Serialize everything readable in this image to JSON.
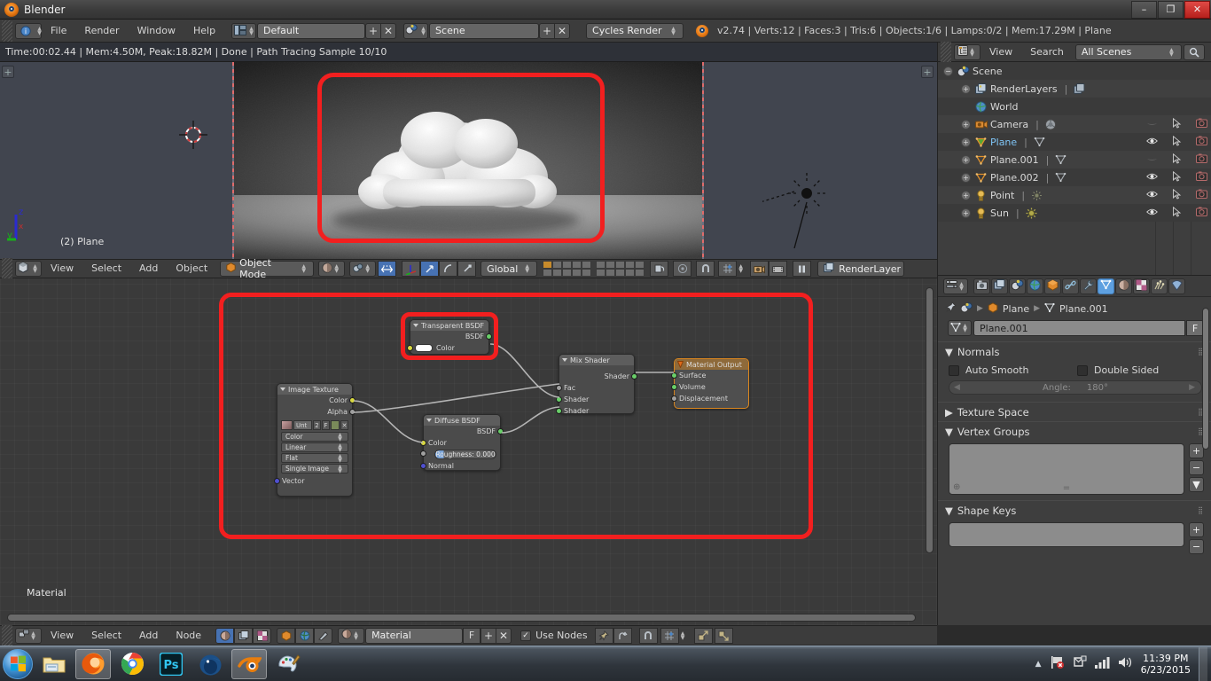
{
  "window": {
    "title": "Blender",
    "icon": "blender-logo-icon",
    "buttons": {
      "minimize": "–",
      "maximize": "❐",
      "close": "✕"
    }
  },
  "topbar": {
    "info_icon": "info-editor-icon",
    "menus": [
      "File",
      "Render",
      "Window",
      "Help"
    ],
    "screen_layout": {
      "icon": "screen-layout-icon",
      "value": "Default",
      "add": "+",
      "remove": "✕"
    },
    "scene": {
      "icon": "scene-icon",
      "value": "Scene",
      "add": "+",
      "remove": "✕"
    },
    "render_engine": {
      "value": "Cycles Render"
    },
    "version_stats": "v2.74 | Verts:12 | Faces:3 | Tris:6 | Objects:1/6 | Lamps:0/2 | Mem:17.29M | Plane"
  },
  "render_info": {
    "text": "Time:00:02.44 | Mem:4.50M, Peak:18.82M | Done | Path Tracing Sample 10/10"
  },
  "viewport": {
    "object_label": "(2) Plane",
    "axis": {
      "x": "x",
      "y": "y",
      "z": "z"
    },
    "cursor": "3d-cursor-icon",
    "lamp": "sun-lamp-icon",
    "render_subject": "cloud render preview"
  },
  "viewport_header": {
    "editor_icon": "3d-view-editor-icon",
    "menus": [
      "View",
      "Select",
      "Add",
      "Object"
    ],
    "mode": "Object Mode",
    "shading": "rendered-shading-icon",
    "pivot": "pivot-icon",
    "manipulator_icons": [
      "translate-manipulator-icon",
      "rotate-manipulator-icon",
      "scale-manipulator-icon"
    ],
    "orientation": "Global",
    "layers_label": "scene-layers",
    "extra_icons": [
      "proportional-edit-icon",
      "snap-magnet-icon",
      "snap-target-icon",
      "render-camera-icon",
      "render-animation-icon",
      "pause-icon"
    ],
    "render_layer": "RenderLayer"
  },
  "node_editor": {
    "area_label": "Material",
    "nodes": [
      {
        "id": "image-texture",
        "title": "Image Texture",
        "outputs": [
          "Color",
          "Alpha"
        ],
        "datablock": {
          "name": "Unt",
          "users": "2",
          "fake_user": "F",
          "new": "new-image-icon",
          "unlink": "✕"
        },
        "dropdowns": [
          "Color",
          "Linear",
          "Flat",
          "Single Image"
        ],
        "inputs": [
          "Vector"
        ]
      },
      {
        "id": "transparent-bsdf",
        "title": "Transparent BSDF",
        "outputs": [
          "BSDF"
        ],
        "inputs": [
          "Color"
        ],
        "color_swatch": "#ffffff"
      },
      {
        "id": "diffuse-bsdf",
        "title": "Diffuse BSDF",
        "outputs": [
          "BSDF"
        ],
        "inputs": [
          "Color",
          "Normal"
        ],
        "roughness_label": "Roughness:",
        "roughness_value": "0.000"
      },
      {
        "id": "mix-shader",
        "title": "Mix Shader",
        "outputs": [
          "Shader"
        ],
        "inputs": [
          "Fac",
          "Shader",
          "Shader"
        ]
      },
      {
        "id": "material-output",
        "title": "Material Output",
        "inputs": [
          "Surface",
          "Volume",
          "Displacement"
        ]
      }
    ],
    "highlight_color": "#f21f1f"
  },
  "node_header": {
    "editor_icon": "node-editor-icon",
    "menus": [
      "View",
      "Select",
      "Add",
      "Node"
    ],
    "tree_type_icons": [
      "shader-nodes-icon",
      "compositing-nodes-icon",
      "texture-nodes-icon"
    ],
    "shader_type_icons": [
      "object-icon",
      "world-icon",
      "linestyle-icon"
    ],
    "datablock": {
      "icon": "material-icon",
      "value": "Material",
      "fake_user": "F",
      "add": "+",
      "remove": "✕"
    },
    "use_nodes": {
      "label": "Use Nodes",
      "checked": true
    },
    "pin_icon": "pin-icon",
    "go_parent_icon": "go-to-parent-icon",
    "snap_icons": [
      "snap-magnet-icon",
      "snap-node-icon"
    ],
    "group_icons": [
      "group-insert-icon",
      "group-exit-icon"
    ]
  },
  "outliner": {
    "editor_icon": "outliner-editor-icon",
    "menus": [
      "View",
      "Search"
    ],
    "display_mode": "All Scenes",
    "search_icon": "magnifier-icon",
    "rows": [
      {
        "name": "Scene",
        "icon": "scene-icon",
        "indent": 0,
        "expander": "−",
        "selected": false,
        "show_toggles": false,
        "datatype": ""
      },
      {
        "name": "RenderLayers",
        "icon": "renderlayers-icon",
        "indent": 1,
        "expander": "+",
        "selected": false,
        "show_toggles": false,
        "datatype": "renderlayer-icon"
      },
      {
        "name": "World",
        "icon": "world-icon",
        "indent": 1,
        "expander": "",
        "selected": false,
        "show_toggles": false,
        "datatype": ""
      },
      {
        "name": "Camera",
        "icon": "camera-icon",
        "indent": 1,
        "expander": "+",
        "selected": false,
        "show_toggles": true,
        "datatype": "camera-data-icon",
        "visible": false
      },
      {
        "name": "Plane",
        "icon": "mesh-icon",
        "indent": 1,
        "expander": "+",
        "selected": true,
        "show_toggles": true,
        "datatype": "mesh-data-icon",
        "visible": true
      },
      {
        "name": "Plane.001",
        "icon": "mesh-icon",
        "indent": 1,
        "expander": "+",
        "selected": false,
        "show_toggles": true,
        "datatype": "mesh-data-icon",
        "visible": false
      },
      {
        "name": "Plane.002",
        "icon": "mesh-icon",
        "indent": 1,
        "expander": "+",
        "selected": false,
        "show_toggles": true,
        "datatype": "mesh-data-icon",
        "visible": true
      },
      {
        "name": "Point",
        "icon": "lamp-icon",
        "indent": 1,
        "expander": "+",
        "selected": false,
        "show_toggles": true,
        "datatype": "point-lamp-icon",
        "visible": true
      },
      {
        "name": "Sun",
        "icon": "lamp-icon",
        "indent": 1,
        "expander": "+",
        "selected": false,
        "show_toggles": true,
        "datatype": "sun-lamp-icon",
        "visible": true
      }
    ]
  },
  "properties": {
    "tabs": [
      {
        "name": "render-tab",
        "icon": "camera-back-icon",
        "active": false
      },
      {
        "name": "renderlayers-tab",
        "icon": "images-icon",
        "active": false
      },
      {
        "name": "scene-tab",
        "icon": "scene-icon",
        "active": false
      },
      {
        "name": "world-tab",
        "icon": "world-icon",
        "active": false
      },
      {
        "name": "object-tab",
        "icon": "cube-icon",
        "active": false
      },
      {
        "name": "constraints-tab",
        "icon": "chain-icon",
        "active": false
      },
      {
        "name": "modifiers-tab",
        "icon": "wrench-icon",
        "active": false
      },
      {
        "name": "data-tab",
        "icon": "mesh-data-icon",
        "active": true
      },
      {
        "name": "material-tab",
        "icon": "material-ball-icon",
        "active": false
      },
      {
        "name": "texture-tab",
        "icon": "checker-icon",
        "active": false
      },
      {
        "name": "particles-tab",
        "icon": "particles-icon",
        "active": false
      },
      {
        "name": "physics-tab",
        "icon": "physics-icon",
        "active": false
      }
    ],
    "editor_icon": "properties-editor-icon",
    "pin_icon": "pin-icon",
    "breadcrumb": {
      "scene_icon": "scene-icon",
      "object": "Plane",
      "data": "Plane.001"
    },
    "datablock": {
      "icon": "mesh-data-icon",
      "value": "Plane.001",
      "fake_user": "F"
    },
    "panels": [
      {
        "title": "Normals",
        "open": true,
        "auto_smooth": {
          "label": "Auto Smooth",
          "checked": false
        },
        "double_sided": {
          "label": "Double Sided",
          "checked": false
        },
        "angle": {
          "label": "Angle:",
          "value": "180°"
        }
      },
      {
        "title": "Texture Space",
        "open": false
      },
      {
        "title": "Vertex Groups",
        "open": true
      },
      {
        "title": "Shape Keys",
        "open": true
      }
    ],
    "list_buttons": {
      "add": "+",
      "remove": "−",
      "menu": "▼"
    }
  },
  "taskbar": {
    "start": "windows-start-icon",
    "items": [
      {
        "name": "file-explorer-icon",
        "running": false
      },
      {
        "name": "firefox-icon",
        "running": true
      },
      {
        "name": "chrome-icon",
        "running": false
      },
      {
        "name": "photoshop-icon",
        "running": false
      },
      {
        "name": "thunderbird-icon",
        "running": false
      },
      {
        "name": "blender-icon",
        "running": true
      },
      {
        "name": "paint-icon",
        "running": false
      }
    ],
    "tray": {
      "show_hidden": "▲",
      "icons": [
        "network-flag-icon",
        "action-center-icon",
        "signal-icon",
        "volume-icon"
      ],
      "time": "11:39 PM",
      "date": "6/23/2015"
    }
  }
}
